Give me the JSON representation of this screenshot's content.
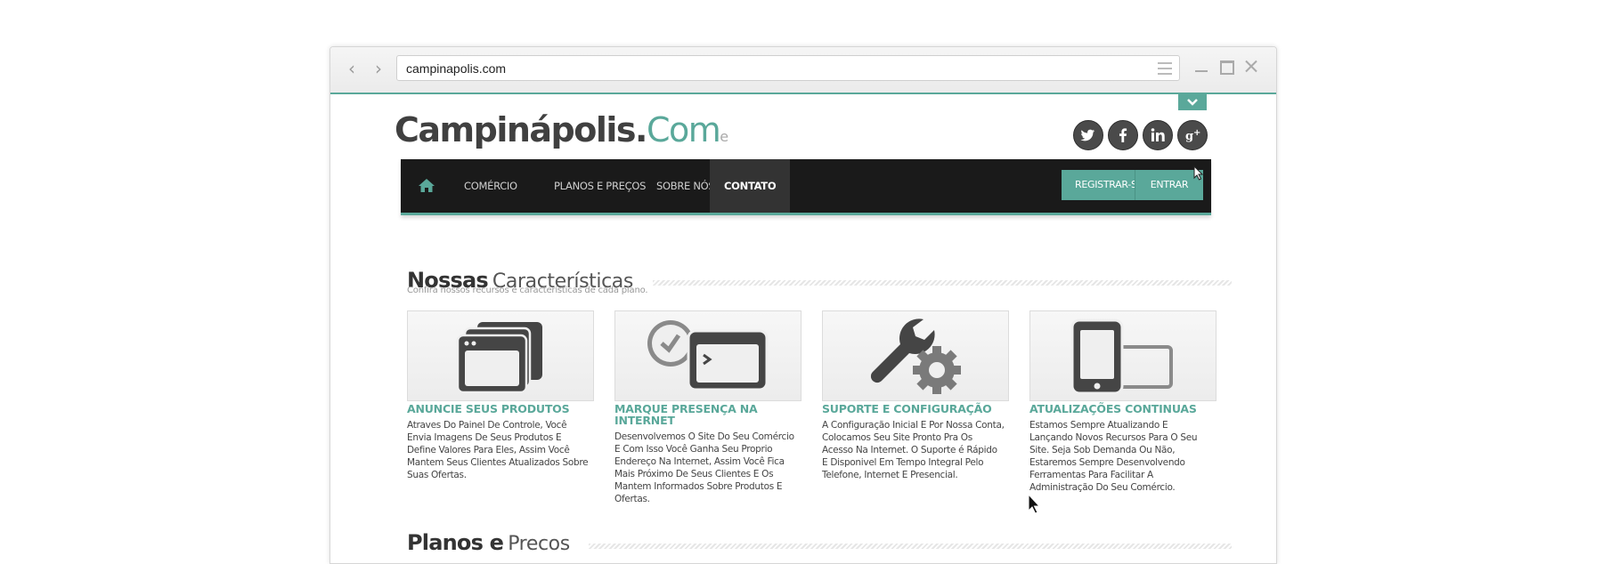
{
  "browser": {
    "url": "campinapolis.com",
    "back_icon": "chevron-left-icon",
    "forward_icon": "chevron-right-icon"
  },
  "site": {
    "logo_main": "Campinápolis.",
    "logo_tld": "Com",
    "logo_tail": "e",
    "social": [
      {
        "name": "twitter",
        "glyph": "t"
      },
      {
        "name": "facebook",
        "glyph": "f"
      },
      {
        "name": "linkedin",
        "glyph": "in"
      },
      {
        "name": "google-plus",
        "glyph": "g+"
      }
    ],
    "accent_color": "#5aa89a"
  },
  "nav": {
    "items": [
      {
        "label": "COMÉRCIO"
      },
      {
        "label": "PLANOS E PREÇOS"
      },
      {
        "label": "SOBRE NÓS"
      },
      {
        "label": "CONTATO"
      }
    ],
    "active": "CONTATO",
    "register": "REGISTRAR-SE",
    "login": "ENTRAR"
  },
  "features_section": {
    "title_bold": "Nossas",
    "title_light": "Características",
    "subtitle": "Confira nossos recursos e características de cada plano."
  },
  "features": [
    {
      "icon": "browser-windows-icon",
      "title": "ANUNCIE SEUS PRODUTOS",
      "description": "Atraves Do Painel De Controle, Você Envia Imagens De Seus Produtos E Define Valores Para Eles, Assim Você Mantem Seus Clientes Atualizados Sobre Suas Ofertas."
    },
    {
      "icon": "clock-terminal-icon",
      "title": "MARQUE PRESENÇA NA INTERNET",
      "description": "Desenvolvemos O Site Do Seu Comércio E Com Isso Você Ganha Seu Proprio Endereço Na Internet, Assim Você Fica Mais Próximo De Seus Clientes E Os Mantem Informados Sobre Produtos E Ofertas."
    },
    {
      "icon": "wrench-gear-icon",
      "title": "SUPORTE E CONFIGURAÇÃO",
      "description": "A Configuração Inicial E Por Nossa Conta, Colocamos Seu Site Pronto Pra Os Acesso Na Internet. O Suporte é Rápido E Disponivel Em Tempo Integral Pelo Telefone, Internet E Presencial."
    },
    {
      "icon": "devices-icon",
      "title": "ATUALIZAÇÕES CONTINUAS",
      "description": "Estamos Sempre Atualizando E Lançando Novos Recursos Para O Seu Site. Seja Sob Demanda Ou Não, Estaremos Sempre Desenvolvendo Ferramentas Para Facilitar A Administração Do Seu Comércio."
    }
  ],
  "plans_section": {
    "title_bold": "Planos e",
    "title_light": "Precos"
  }
}
